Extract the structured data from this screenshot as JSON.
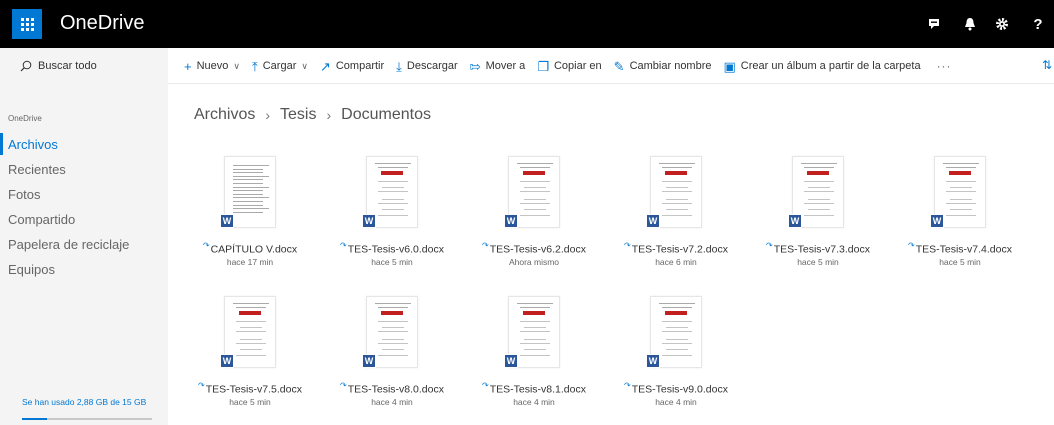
{
  "app": {
    "title": "OneDrive"
  },
  "suite_icons": [
    "chat-icon",
    "bell-icon",
    "gear-icon",
    "help-icon"
  ],
  "suite_help_label": "?",
  "command_bar": {
    "search_placeholder": "Buscar todo",
    "new_label": "Nuevo",
    "upload_label": "Cargar",
    "share_label": "Compartir",
    "download_label": "Descargar",
    "move_label": "Mover a",
    "copy_label": "Copiar en",
    "rename_label": "Cambiar nombre",
    "album_label": "Crear un álbum a partir de la carpeta",
    "more_label": "···"
  },
  "sidebar": {
    "header": "OneDrive",
    "items": [
      {
        "label": "Archivos",
        "selected": true
      },
      {
        "label": "Recientes",
        "selected": false
      },
      {
        "label": "Fotos",
        "selected": false
      },
      {
        "label": "Compartido",
        "selected": false
      },
      {
        "label": "Papelera de reciclaje",
        "selected": false
      },
      {
        "label": "Equipos",
        "selected": false
      }
    ],
    "storage_text": "Se han usado 2,88 GB de 15 GB",
    "storage_fraction": 0.19
  },
  "breadcrumb": [
    "Archivos",
    "Tesis",
    "Documentos"
  ],
  "files": [
    {
      "name": "CAPÍTULO V.docx",
      "modified": "hace 17 min"
    },
    {
      "name": "TES-Tesis-v6.0.docx",
      "modified": "hace 5 min"
    },
    {
      "name": "TES-Tesis-v6.2.docx",
      "modified": "Ahora mismo"
    },
    {
      "name": "TES-Tesis-v7.2.docx",
      "modified": "hace 6 min"
    },
    {
      "name": "TES-Tesis-v7.3.docx",
      "modified": "hace 5 min"
    },
    {
      "name": "TES-Tesis-v7.4.docx",
      "modified": "hace 5 min"
    },
    {
      "name": "TES-Tesis-v7.5.docx",
      "modified": "hace 5 min"
    },
    {
      "name": "TES-Tesis-v8.0.docx",
      "modified": "hace 4 min"
    },
    {
      "name": "TES-Tesis-v8.1.docx",
      "modified": "hace 4 min"
    },
    {
      "name": "TES-Tesis-v9.0.docx",
      "modified": "hace 4 min"
    }
  ],
  "colors": {
    "accent": "#0078d4",
    "word": "#2b579a",
    "suite_bar": "#000000"
  }
}
